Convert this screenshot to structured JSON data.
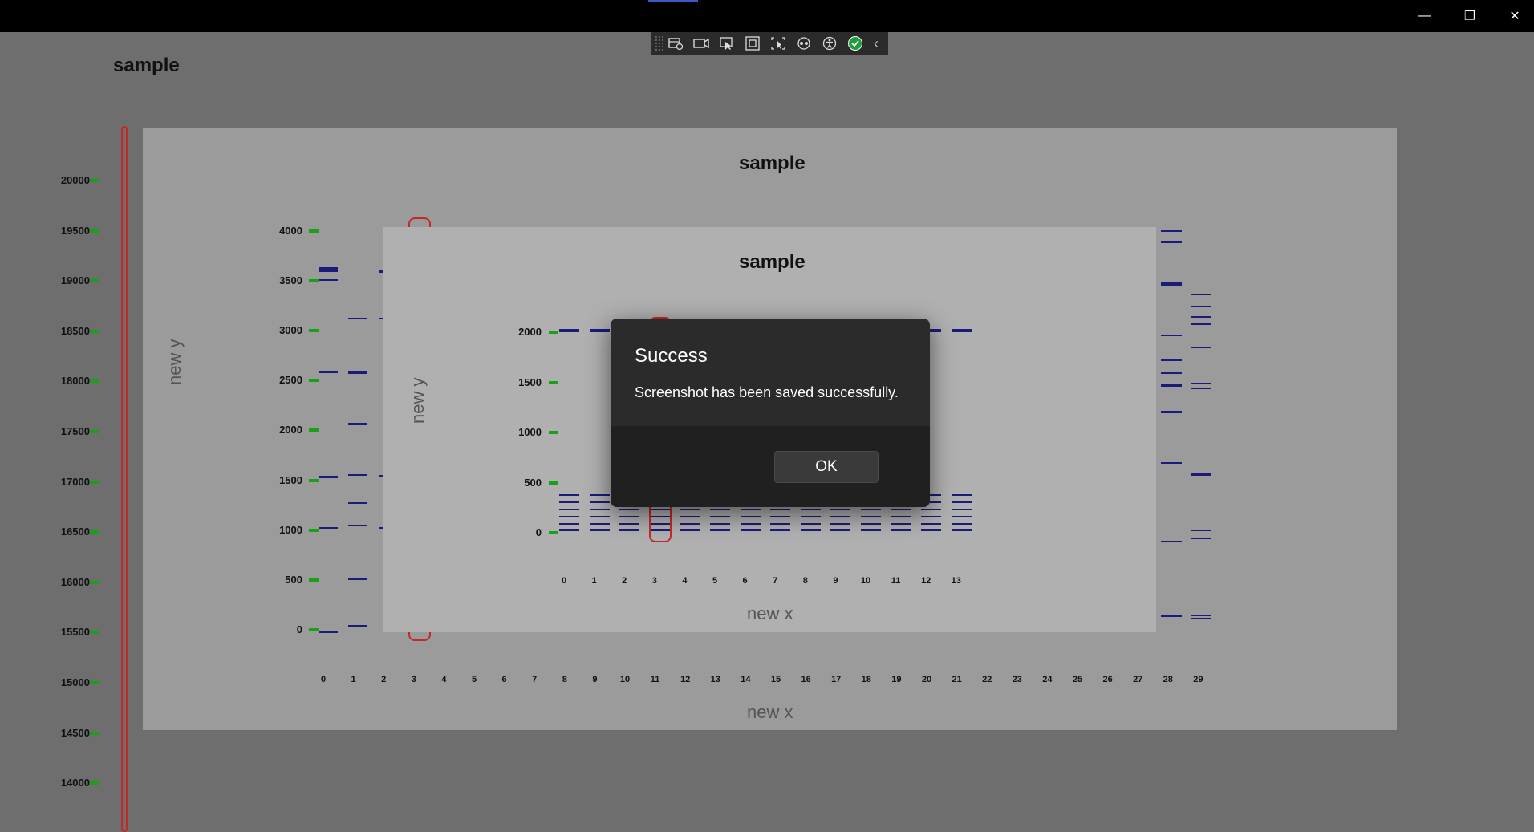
{
  "window": {
    "minimize_glyph": "—",
    "restore_glyph": "❐",
    "close_glyph": "✕"
  },
  "toolbar": {
    "icons": [
      "record-settings-icon",
      "camera-icon",
      "cursor-select-icon",
      "square-select-icon",
      "region-select-icon",
      "spy-icon",
      "accessibility-icon",
      "check-circle-icon",
      "collapse-chevron-icon"
    ],
    "collapse_glyph": "‹",
    "check_color": "#1e9e3a"
  },
  "app": {
    "title": "sample"
  },
  "outer_axis": {
    "ticks": [
      "20000",
      "19500",
      "19000",
      "18500",
      "18000",
      "17500",
      "17000",
      "16500",
      "16000",
      "15500",
      "15000",
      "14500",
      "14000"
    ]
  },
  "panel1": {
    "title": "sample",
    "ylabel": "new y",
    "xlabel": "new x",
    "yticks": [
      "4000",
      "3500",
      "3000",
      "2500",
      "2000",
      "1500",
      "1000",
      "500",
      "0"
    ],
    "xticks": [
      "0",
      "1",
      "2",
      "3",
      "4",
      "5",
      "6",
      "7",
      "8",
      "9",
      "10",
      "11",
      "12",
      "13",
      "14",
      "15",
      "16",
      "17",
      "18",
      "19",
      "20",
      "21",
      "22",
      "23",
      "24",
      "25",
      "26",
      "27",
      "28",
      "29"
    ]
  },
  "panel2": {
    "title": "sample",
    "ylabel": "new y",
    "xlabel": "new x",
    "yticks": [
      "2000",
      "1500",
      "1000",
      "500",
      "0"
    ],
    "xticks": [
      "0",
      "1",
      "2",
      "3",
      "4",
      "5",
      "6",
      "7",
      "8",
      "9",
      "10",
      "11",
      "12",
      "13"
    ]
  },
  "dialog": {
    "title": "Success",
    "message": "Screenshot has been saved successfully.",
    "ok_label": "OK"
  },
  "colors": {
    "background": "#6e6e6e",
    "panel_outer": "#9b9b9b",
    "panel_inner": "#b0b0b0",
    "band": "#1b1b7a",
    "marker": "#19a019",
    "highlight": "#d02020"
  }
}
